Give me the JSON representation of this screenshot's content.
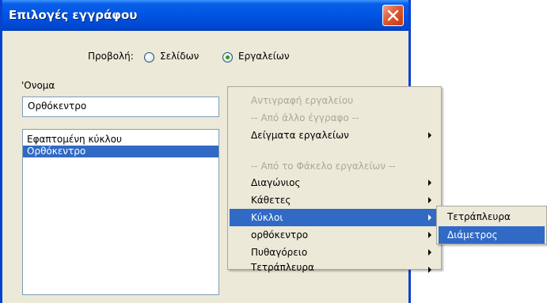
{
  "window": {
    "title": "Επιλογές εγγράφου",
    "close_icon": "close-icon"
  },
  "view": {
    "label": "Προβολή:",
    "option_pages": "Σελίδων",
    "option_tools": "Εργαλείων",
    "selected": "Εργαλείων"
  },
  "name": {
    "label": "'Ονομα",
    "value": "Ορθόκεντρο"
  },
  "tool_list": {
    "items": [
      "Εφαπτομένη κύκλου",
      "Ορθόκεντρο"
    ],
    "selected_index": 1
  },
  "context_menu": {
    "copy_tool": "Αντιγραφή εργαλείου",
    "from_other_doc": "-- Από άλλο έγγραφο --",
    "sample_tools": "Δείγματα εργαλείων",
    "from_tools_folder": "-- Από το Φάκελο εργαλείων --",
    "items": [
      "Διαγώνιος",
      "Κάθετες",
      "Κύκλοι",
      "ορθόκεντρο",
      "Πυθαγόρειο",
      "Τετράπλευρα"
    ],
    "highlighted": "Κύκλοι"
  },
  "submenu": {
    "items": [
      "Τετράπλευρα",
      "Διάμετρος"
    ],
    "highlighted": "Διάμετρος"
  },
  "colors": {
    "titlebar": "#0054e3",
    "selection": "#316ac5",
    "dialog_bg": "#ece9d8",
    "close_button": "#e0582f"
  }
}
